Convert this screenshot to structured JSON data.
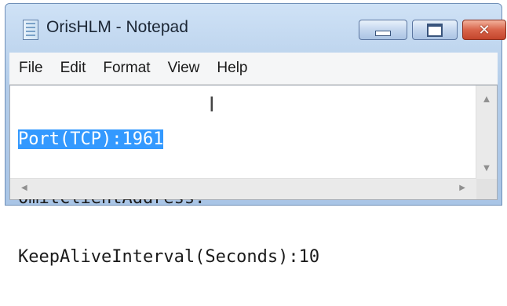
{
  "window": {
    "title": "OrisHLM - Notepad",
    "buttons": {
      "minimize": "minimize-icon",
      "maximize": "maximize-icon",
      "close": "close-icon",
      "close_glyph": "✕"
    }
  },
  "menu": {
    "items": [
      "File",
      "Edit",
      "Format",
      "View",
      "Help"
    ]
  },
  "document": {
    "lines": [
      {
        "selected": "Port(TCP):1961",
        "rest": ""
      },
      {
        "selected": "",
        "rest": "OmitClientAddress:"
      },
      {
        "selected": "",
        "rest": "KeepAliveInterval(Seconds):10"
      }
    ]
  },
  "scrollbars": {
    "up_arrow": "▲",
    "down_arrow": "▼",
    "left_arrow": "◀",
    "right_arrow": "▶"
  },
  "colors": {
    "selection": "#3399ff",
    "close_button": "#d9644a"
  }
}
